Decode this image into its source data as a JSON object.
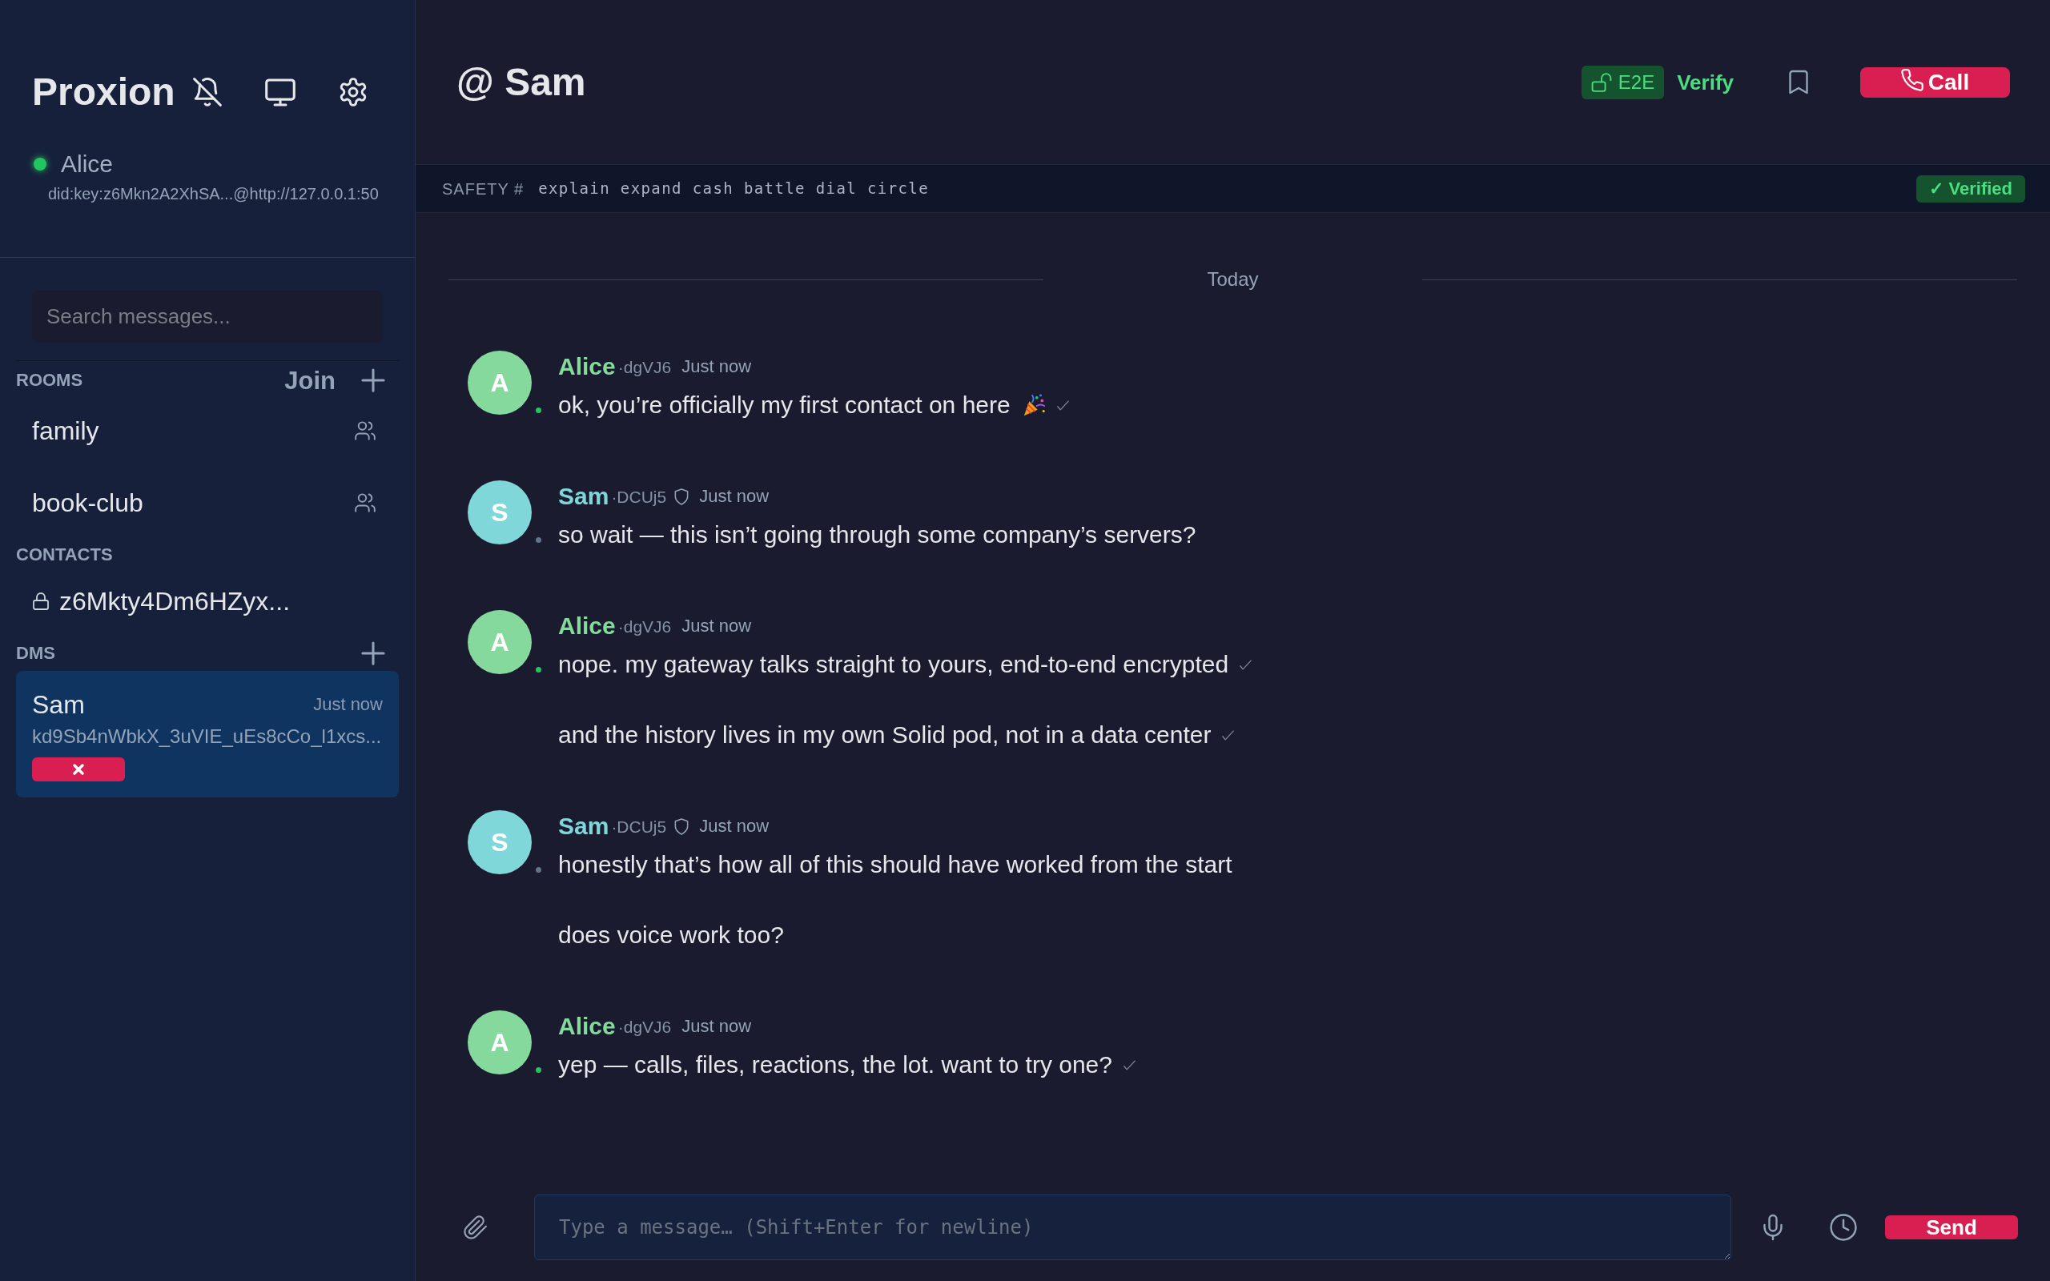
{
  "sidebar": {
    "app_title": "Proxion",
    "user": {
      "name": "Alice",
      "online": true,
      "address": "did:key:z6Mkn2A2XhSA...@http://127.0.0.1:50"
    },
    "search": {
      "placeholder": "Search messages..."
    },
    "rooms": {
      "heading": "ROOMS",
      "join_label": "Join",
      "items": [
        {
          "name": "family",
          "selected": false
        },
        {
          "name": "book-club",
          "selected": false
        }
      ]
    },
    "contacts": {
      "heading": "CONTACTS",
      "items": [
        {
          "name": "z6Mkty4Dm6HZyx...",
          "selected": false
        }
      ]
    },
    "dms": {
      "heading": "DMS",
      "items": [
        {
          "name": "Sam",
          "time": "Just now",
          "preview": "kd9Sb4nWbkX_3uVIE_uEs8cCo_l1xcs...",
          "selected": true,
          "x_badge": true
        }
      ]
    }
  },
  "chat": {
    "title": "@ Sam",
    "e2e_label": "E2E",
    "verify_label": "Verify",
    "call_label": "Call",
    "safety": {
      "label": "SAFETY #",
      "words": "explain expand cash battle dial circle",
      "status": "✓ Verified"
    },
    "date_divider": "Today",
    "messages": [
      {
        "initial": "A",
        "sender": "Alice",
        "key": "·dgVJ6",
        "time": "Just now",
        "color": "#86d99c",
        "online": true,
        "verified": false,
        "lines": [
          {
            "text": "ok, you’re officially my first contact on here",
            "emoji": true,
            "delivered": true
          }
        ]
      },
      {
        "initial": "S",
        "sender": "Sam",
        "key": "·DCUj5",
        "time": "Just now",
        "color": "#80d7d9",
        "online": false,
        "verified": true,
        "lines": [
          {
            "text": "so wait — this isn’t going through some company’s servers?",
            "emoji": false,
            "delivered": false
          }
        ]
      },
      {
        "initial": "A",
        "sender": "Alice",
        "key": "·dgVJ6",
        "time": "Just now",
        "color": "#86d99c",
        "online": true,
        "verified": false,
        "lines": [
          {
            "text": "nope. my gateway talks straight to yours, end-to-end encrypted",
            "emoji": false,
            "delivered": true
          },
          {
            "text": "and the history lives in my own Solid pod, not in a data center",
            "emoji": false,
            "delivered": true
          }
        ]
      },
      {
        "initial": "S",
        "sender": "Sam",
        "key": "·DCUj5",
        "time": "Just now",
        "color": "#80d7d9",
        "online": false,
        "verified": true,
        "lines": [
          {
            "text": "honestly that’s how all of this should have worked from the start",
            "emoji": false,
            "delivered": false
          },
          {
            "text": "does voice work too?",
            "emoji": false,
            "delivered": false
          }
        ]
      },
      {
        "initial": "A",
        "sender": "Alice",
        "key": "·dgVJ6",
        "time": "Just now",
        "color": "#86d99c",
        "online": true,
        "verified": false,
        "lines": [
          {
            "text": "yep — calls, files, reactions, the lot. want to try one?",
            "emoji": false,
            "delivered": true
          }
        ]
      }
    ],
    "composer": {
      "placeholder": "Type a message… (Shift+Enter for newline)",
      "send_label": "Send"
    }
  }
}
